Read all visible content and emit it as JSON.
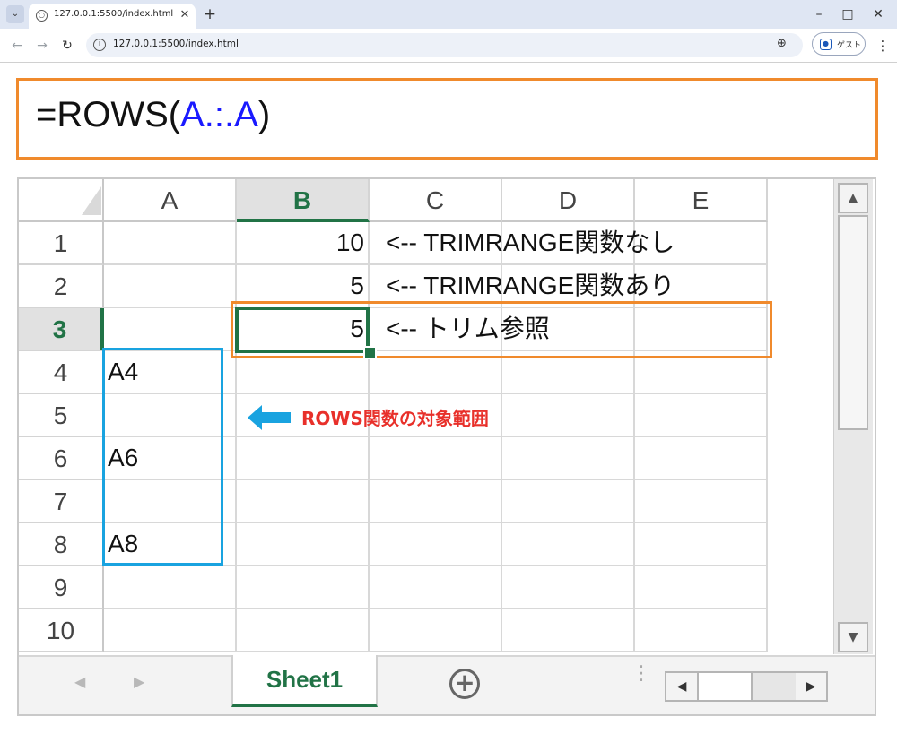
{
  "browser": {
    "tab_title": "127.0.0.1:5500/index.html",
    "url": "127.0.0.1:5500/index.html",
    "guest_label": "ゲスト",
    "icons": [
      "tab-menu-icon",
      "globe-icon",
      "close-icon",
      "plus-icon",
      "minimize-icon",
      "maximize-icon",
      "close-window-icon",
      "back-icon",
      "forward-icon",
      "reload-icon",
      "info-icon",
      "zoom-icon",
      "profile-icon",
      "kebab-menu-icon"
    ]
  },
  "formula": {
    "prefix": "=ROWS(",
    "ref": "A.:.A",
    "suffix": ")"
  },
  "sheet": {
    "columns": [
      "A",
      "B",
      "C",
      "D",
      "E"
    ],
    "selected_column": "B",
    "rows": [
      "1",
      "2",
      "3",
      "4",
      "5",
      "6",
      "7",
      "8",
      "9",
      "10"
    ],
    "selected_row": "3",
    "cells": {
      "B1": "10",
      "C1": "<-- TRIMRANGE関数なし",
      "B2": "5",
      "C2": "<-- TRIMRANGE関数あり",
      "B3": "5",
      "C3": "<-- トリム参照",
      "A4": "A4",
      "A6": "A6",
      "A8": "A8"
    },
    "active_cell": "B3"
  },
  "annotation": {
    "text": "ROWS関数の対象範囲",
    "color": "#e8302a",
    "arrow_color": "#19a3e0"
  },
  "tabs": {
    "sheet_name": "Sheet1"
  },
  "colors": {
    "excel_green": "#217346",
    "highlight_orange": "#f08a2c",
    "range_blue": "#19a3e0",
    "ref_blue": "#1a1aff"
  }
}
